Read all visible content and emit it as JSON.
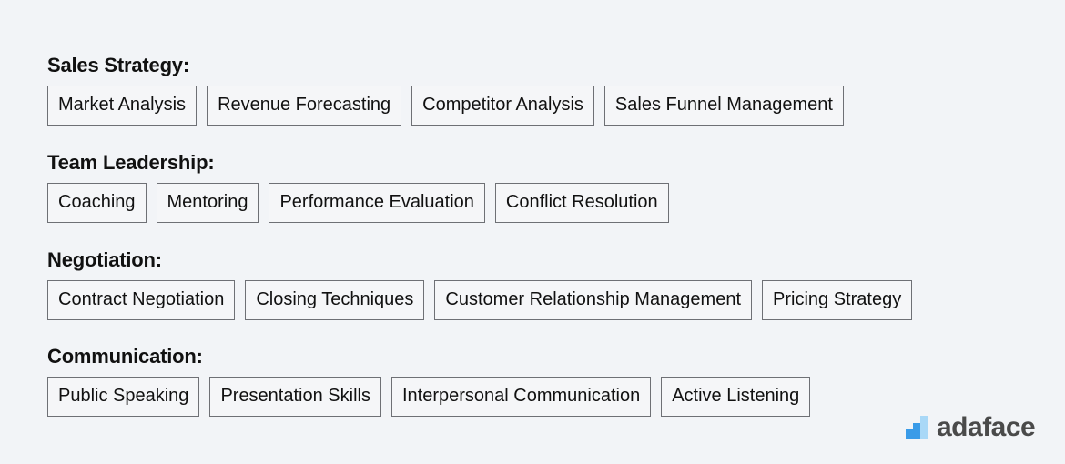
{
  "sections": [
    {
      "heading": "Sales Strategy:",
      "skills": [
        "Market Analysis",
        "Revenue Forecasting",
        "Competitor Analysis",
        "Sales Funnel Management"
      ]
    },
    {
      "heading": "Team Leadership:",
      "skills": [
        "Coaching",
        "Mentoring",
        "Performance Evaluation",
        "Conflict Resolution"
      ]
    },
    {
      "heading": "Negotiation:",
      "skills": [
        "Contract Negotiation",
        "Closing Techniques",
        "Customer Relationship Management",
        "Pricing Strategy"
      ]
    },
    {
      "heading": "Communication:",
      "skills": [
        "Public Speaking",
        "Presentation Skills",
        "Interpersonal Communication",
        "Active Listening"
      ]
    }
  ],
  "logo": {
    "text": "adaface",
    "icon": "bar-steps-icon",
    "colors": {
      "dark": "#3a9be8",
      "light": "#a9d8f7",
      "text": "#4a4a4a"
    }
  }
}
